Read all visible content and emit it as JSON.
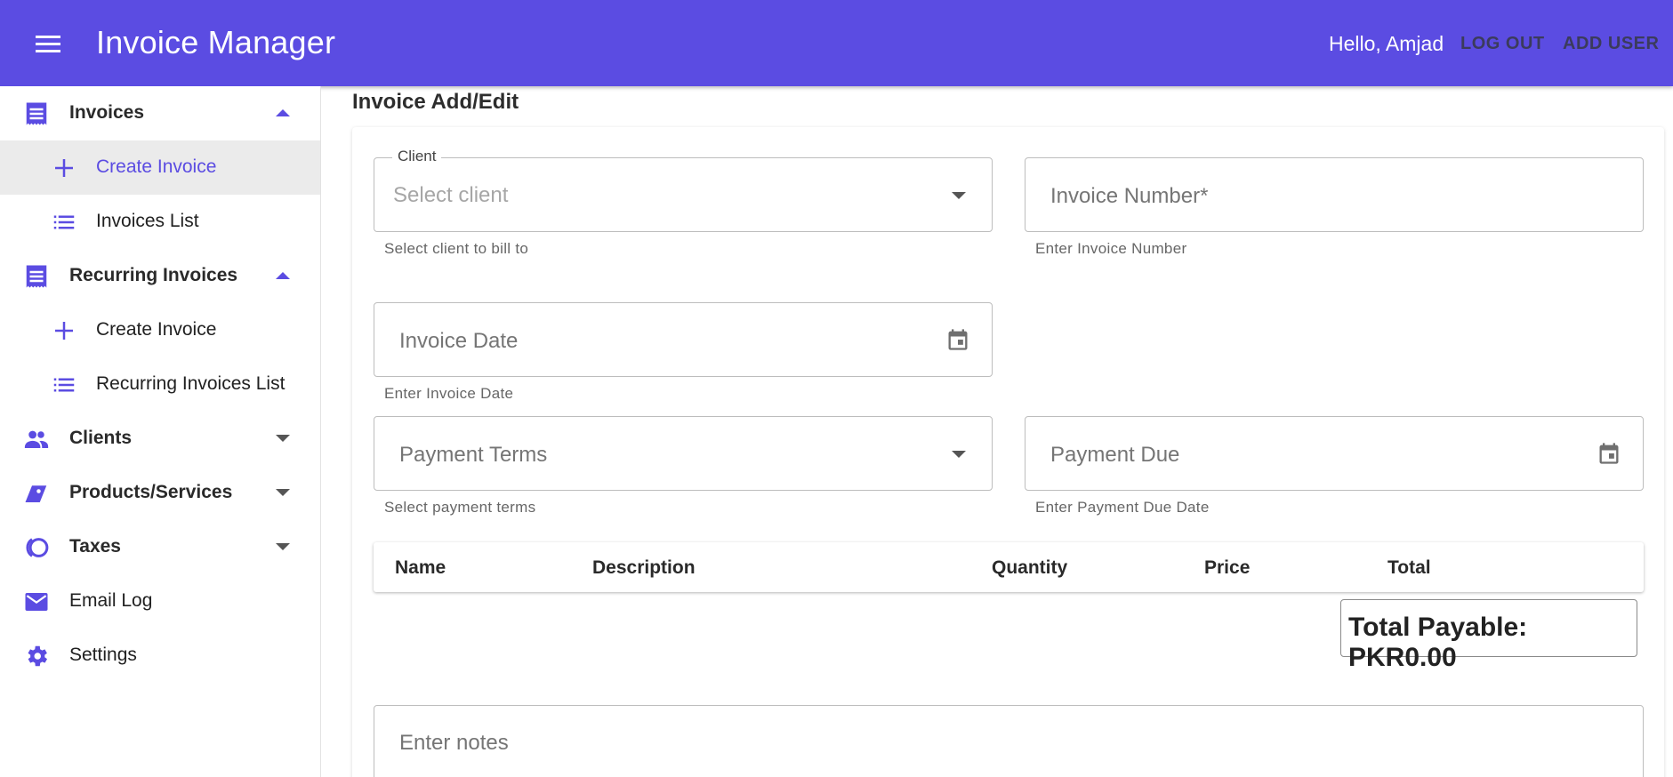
{
  "header": {
    "title": "Invoice Manager",
    "greeting": "Hello, Amjad",
    "logout_label": "LOG OUT",
    "add_user_label": "ADD USER"
  },
  "sidebar": {
    "items": [
      {
        "label": "Invoices",
        "icon": "receipt-icon"
      },
      {
        "label": "Create Invoice",
        "icon": "plus-icon"
      },
      {
        "label": "Invoices List",
        "icon": "list-icon"
      },
      {
        "label": "Recurring Invoices",
        "icon": "receipt-icon"
      },
      {
        "label": "Create Invoice",
        "icon": "plus-icon"
      },
      {
        "label": "Recurring Invoices List",
        "icon": "list-icon"
      },
      {
        "label": "Clients",
        "icon": "people-icon"
      },
      {
        "label": "Products/Services",
        "icon": "tag-icon"
      },
      {
        "label": "Taxes",
        "icon": "taxes-icon"
      },
      {
        "label": "Email Log",
        "icon": "mail-icon"
      },
      {
        "label": "Settings",
        "icon": "gear-icon"
      }
    ]
  },
  "main": {
    "page_title": "Invoice Add/Edit",
    "client": {
      "legend": "Client",
      "placeholder": "Select client",
      "helper": "Select client to bill to"
    },
    "invoice_number": {
      "placeholder": "Invoice Number*",
      "helper": "Enter Invoice Number"
    },
    "invoice_date": {
      "placeholder": "Invoice Date",
      "helper": "Enter Invoice Date"
    },
    "payment_terms": {
      "placeholder": "Payment Terms",
      "helper": "Select payment terms"
    },
    "payment_due": {
      "placeholder": "Payment Due",
      "helper": "Enter Payment Due Date"
    },
    "table": {
      "columns": [
        "Name",
        "Description",
        "Quantity",
        "Price",
        "Total"
      ]
    },
    "total_payable": "Total Payable: PKR0.00",
    "notes_placeholder": "Enter notes"
  },
  "colors": {
    "primary": "#5b4ce2",
    "active_bg": "#ebebeb"
  }
}
